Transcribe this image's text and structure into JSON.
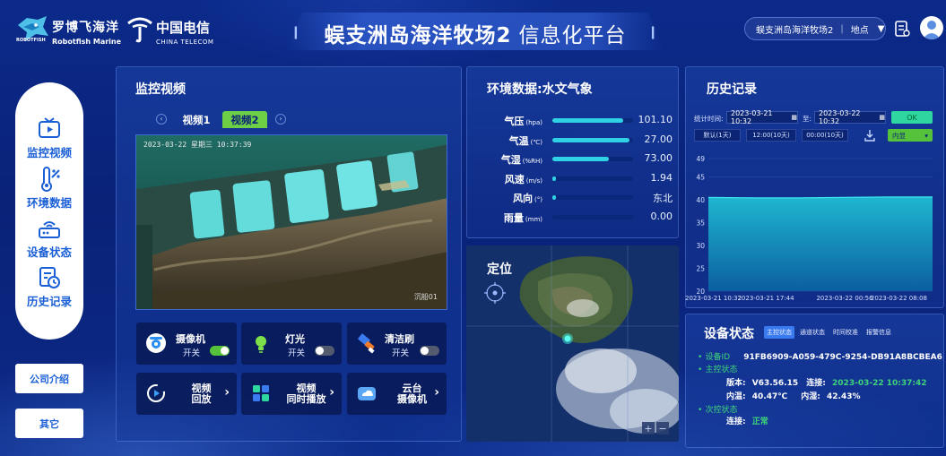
{
  "header": {
    "brand1_cn": "罗博飞海洋",
    "brand1_en": "Robotfish Marine",
    "brand1_sub": "ROBOTFISH",
    "brand2_cn": "中国电信",
    "brand2_en": "CHINA TELECOM",
    "title_main": "蜈支洲岛海洋牧场2",
    "title_sub": "信息化平台",
    "location_value": "蜈支洲岛海洋牧场2",
    "location_label": "地点"
  },
  "nav": {
    "items": [
      {
        "label": "监控视频",
        "icon": "tv-icon"
      },
      {
        "label": "环境数据",
        "icon": "thermometer-icon"
      },
      {
        "label": "设备状态",
        "icon": "router-icon"
      },
      {
        "label": "历史记录",
        "icon": "history-icon"
      }
    ],
    "company_btn": "公司介绍",
    "other_btn": "其它"
  },
  "video": {
    "title": "监控视频",
    "tabs": [
      "视频1",
      "视频2"
    ],
    "active_tab": 1,
    "timestamp": "2023-03-22 星期三 10:37:39",
    "camera_label": "沉船01",
    "controls": [
      {
        "name": "摄像机",
        "state": "开关",
        "on": true,
        "icon": "camera-icon"
      },
      {
        "name": "灯光",
        "state": "开关",
        "on": false,
        "icon": "bulb-icon"
      },
      {
        "name": "清洁刷",
        "state": "开关",
        "on": false,
        "icon": "brush-icon"
      }
    ],
    "actions": [
      {
        "label_l1": "视频",
        "label_l2": "回放",
        "icon": "replay-icon"
      },
      {
        "label_l1": "视频",
        "label_l2": "同时播放",
        "icon": "multi-play-icon"
      },
      {
        "label_l1": "云台",
        "label_l2": "摄像机",
        "icon": "cloud-camera-icon"
      }
    ]
  },
  "env": {
    "title": "环境数据:水文气象",
    "rows": [
      {
        "label": "气压",
        "unit": "(hpa)",
        "value": "101.10",
        "fraction": 0.88
      },
      {
        "label": "气温",
        "unit": "(℃)",
        "value": "27.00",
        "fraction": 0.95
      },
      {
        "label": "气湿",
        "unit": "(%RH)",
        "value": "73.00",
        "fraction": 0.7
      },
      {
        "label": "风速",
        "unit": "(m/s)",
        "value": "1.94",
        "fraction": 0.04
      },
      {
        "label": "风向",
        "unit": "(°)",
        "value": "东北",
        "fraction": 0.04
      },
      {
        "label": "雨量",
        "unit": "(mm)",
        "value": "0.00",
        "fraction": 0.0
      }
    ]
  },
  "map": {
    "title": "定位"
  },
  "history": {
    "title": "历史记录",
    "time_label": "统计时间:",
    "start": "2023-03-21 10:32",
    "to_label": "至:",
    "end": "2023-03-22 10:32",
    "ok": "OK",
    "ranges": [
      "默认(1天)",
      "12:00(10天)",
      "00:00(10天)"
    ],
    "select_value": "内显",
    "chart_data": {
      "type": "area",
      "x": [
        "2023-03-21 10:32",
        "2023-03-21 17:44",
        "2023-03-22 00:56",
        "2023-03-22 08:08"
      ],
      "x_labels": [
        "2023-03-21 10:32",
        "2023-03-21 17:44",
        "2023-03-22 00:56",
        "2023-03-22 08:08"
      ],
      "y_ticks": [
        "49",
        "45",
        "40",
        "35",
        "30",
        "25",
        "20"
      ],
      "ylim": [
        20,
        49
      ],
      "series": [
        {
          "values": [
            40.5,
            40.4,
            40.4,
            40.5,
            40.6,
            40.6
          ]
        }
      ],
      "title": "",
      "xlabel": "",
      "ylabel": ""
    }
  },
  "device": {
    "title": "设备状态",
    "tabs": [
      "主控状态",
      "通道状态",
      "时间校准",
      "报警信息"
    ],
    "device_id_label": "设备ID",
    "device_id": "91FB6909-A059-479C-9254-DB91A8BCBEA6",
    "main_status_label": "主控状态",
    "version_label": "版本:",
    "version": "V63.56.15",
    "connect_label": "连接:",
    "connect_time": "2023-03-22 10:37:42",
    "temp_label": "内温:",
    "temp": "40.47℃",
    "humid_label": "内湿:",
    "humid": "42.43%",
    "sub_status_label": "次控状态",
    "sub_connect_label": "连接:",
    "sub_connect": "正常"
  },
  "colors": {
    "accent_green": "#56c23c",
    "accent_cyan": "#2fd1e4",
    "nav_blue": "#1a5fd6"
  }
}
